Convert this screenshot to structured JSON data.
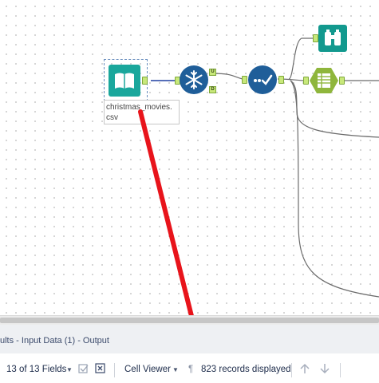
{
  "canvas": {
    "tool_input_label": "christmas_movies.\ncsv",
    "connector_u": "U",
    "connector_d": "D"
  },
  "results": {
    "title": "ults - Input Data (1) - Output"
  },
  "toolbar": {
    "fields_label": "13 of 13 Fields",
    "viewer_label": "Cell Viewer",
    "records_label": "823 records displayed"
  },
  "annotation": {
    "arrow_color": "#e8141b"
  },
  "colors": {
    "input_tool": "#1aa79c",
    "unique_tool": "#1f5e99",
    "select_tool": "#1f5e99",
    "browse_tool": "#12998e",
    "formula_tool": "#8fb63c"
  }
}
